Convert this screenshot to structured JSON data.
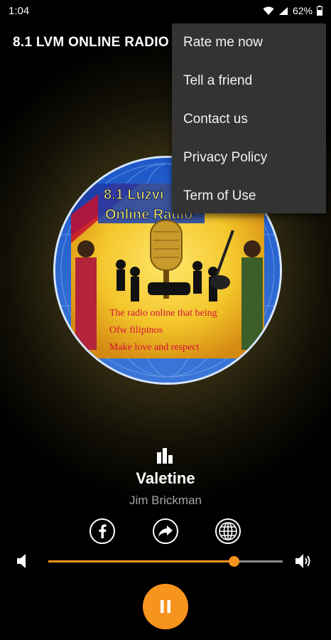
{
  "status_bar": {
    "time": "1:04",
    "battery": "62%",
    "icons": [
      "wifi-icon",
      "signal-icon",
      "battery-icon"
    ]
  },
  "toolbar": {
    "title": "8.1 LVM ONLINE RADIO"
  },
  "overflow_menu": {
    "items": [
      {
        "label": "Rate me now"
      },
      {
        "label": "Tell a friend"
      },
      {
        "label": "Contact us"
      },
      {
        "label": "Privacy Policy"
      },
      {
        "label": "Term of Use"
      }
    ]
  },
  "cover_art": {
    "line1": "8.1 Luzvi",
    "line2": "Online Radio",
    "tagline": [
      "The radio online that being",
      "Ofw filipinos",
      "Make love and respect"
    ]
  },
  "now_playing": {
    "title": "Valetine",
    "artist": "Jim Brickman"
  },
  "actions": [
    "facebook-icon",
    "share-icon",
    "globe-icon"
  ],
  "volume": {
    "level": 0.79
  },
  "colors": {
    "accent": "#f7941d",
    "menu_bg": "#333333",
    "artist_text": "#a5a5a5"
  }
}
